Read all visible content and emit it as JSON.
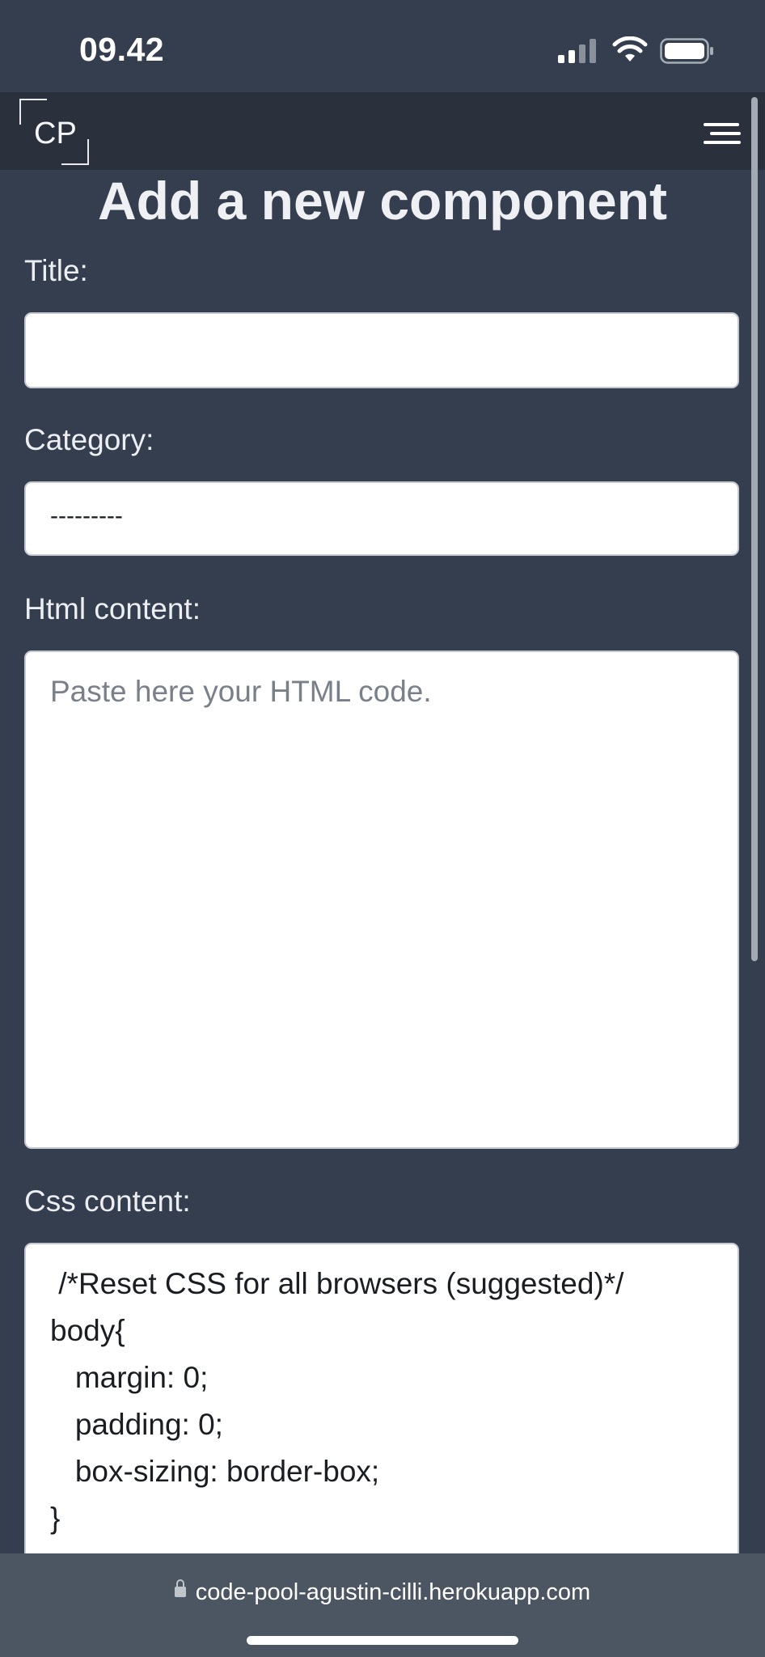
{
  "status_bar": {
    "time": "09.42"
  },
  "navbar": {
    "logo_text": "CP"
  },
  "page": {
    "title": "Add a new component",
    "fields": {
      "title": {
        "label": "Title:",
        "value": ""
      },
      "category": {
        "label": "Category:",
        "value": "---------"
      },
      "html_content": {
        "label": "Html content:",
        "placeholder": "Paste here your HTML code."
      },
      "css_content": {
        "label": "Css content:",
        "value": " /*Reset CSS for all browsers (suggested)*/\nbody{\n   margin: 0;\n   padding: 0;\n   box-sizing: border-box;\n}"
      }
    }
  },
  "browser": {
    "url": "code-pool-agustin-cilli.herokuapp.com"
  },
  "icons": {
    "signal": "cellular-signal-icon",
    "wifi": "wifi-icon",
    "battery": "battery-icon",
    "menu": "hamburger-menu-icon",
    "lock": "lock-icon"
  },
  "colors": {
    "page_background": "#343e4f",
    "navbar_background": "#2a313d",
    "browser_bar_background": "#4c5562",
    "input_background": "#ffffff",
    "placeholder_text": "#7a8089"
  }
}
